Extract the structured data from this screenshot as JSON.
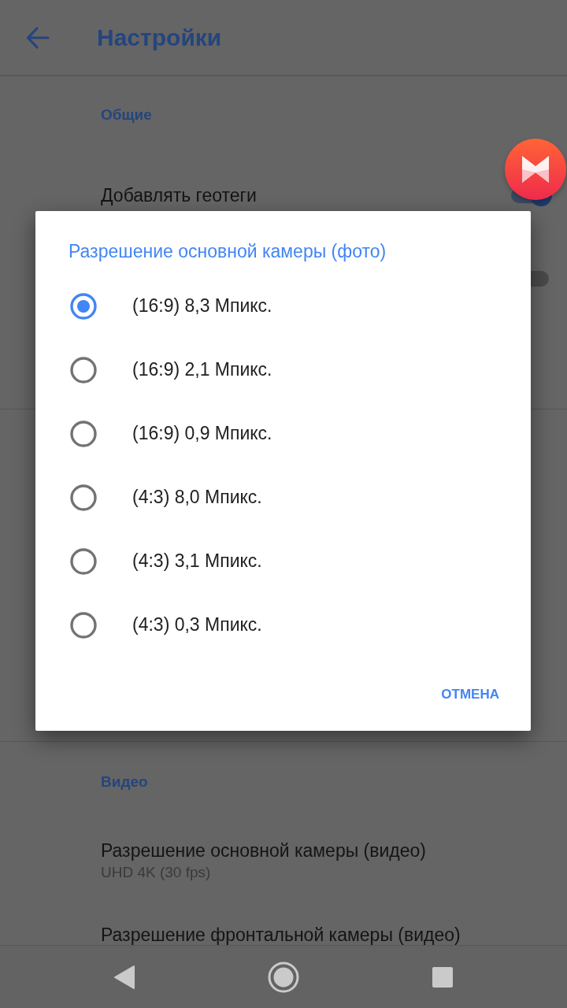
{
  "app_bar": {
    "title": "Настройки"
  },
  "sections": [
    {
      "header": "Общие",
      "items": [
        {
          "kind": "switch",
          "title": "Добавлять геотеги",
          "on": true
        },
        {
          "kind": "switch",
          "on": false
        }
      ]
    },
    {
      "header": "Видео",
      "items": [
        {
          "kind": "value",
          "title": "Разрешение основной камеры (видео)",
          "summary": "UHD 4K (30 fps)"
        },
        {
          "kind": "value",
          "title": "Разрешение фронтальной камеры (видео)"
        }
      ]
    }
  ],
  "dialog": {
    "title": "Разрешение основной камеры (фото)",
    "options": [
      {
        "label": "(16:9) 8,3 Мпикс.",
        "selected": true
      },
      {
        "label": "(16:9) 2,1 Мпикс.",
        "selected": false
      },
      {
        "label": "(16:9) 0,9 Мпикс.",
        "selected": false
      },
      {
        "label": "(4:3) 8,0 Мпикс.",
        "selected": false
      },
      {
        "label": "(4:3) 3,1 Мпикс.",
        "selected": false
      },
      {
        "label": "(4:3) 0,3 Мпикс.",
        "selected": false
      }
    ],
    "buttons": [
      "ОТМЕНА"
    ]
  },
  "nav_bar": {
    "buttons": [
      {
        "kind": "back"
      },
      {
        "kind": "home"
      },
      {
        "kind": "recents"
      }
    ]
  }
}
